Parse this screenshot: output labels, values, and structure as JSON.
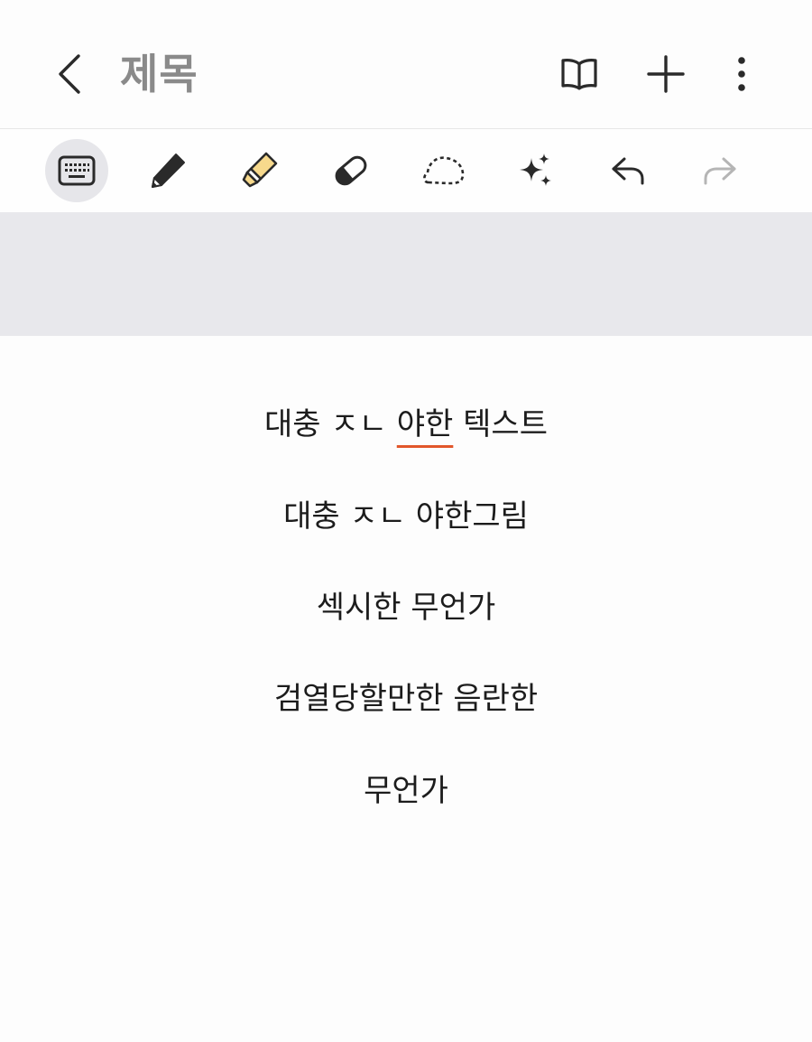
{
  "header": {
    "back_icon": "chevron-left-icon",
    "title": "제목",
    "actions": [
      {
        "icon": "book-open-icon"
      },
      {
        "icon": "plus-icon"
      },
      {
        "icon": "more-vertical-icon"
      }
    ]
  },
  "toolbar": {
    "tools": [
      {
        "icon": "keyboard-icon",
        "active": true
      },
      {
        "icon": "pen-icon",
        "active": false
      },
      {
        "icon": "highlighter-icon",
        "active": false
      },
      {
        "icon": "eraser-icon",
        "active": false
      },
      {
        "icon": "lasso-icon",
        "active": false
      },
      {
        "icon": "sparkle-icon",
        "active": false
      },
      {
        "icon": "undo-icon",
        "active": false
      },
      {
        "icon": "redo-icon",
        "active": false,
        "disabled": true
      }
    ]
  },
  "colors": {
    "title": "#8a8a8a",
    "band": "#e8e8ec",
    "highlighter": "#f7d98c",
    "spellcheck_underline": "#e2572b",
    "active_tool_bg": "#e6e6ea",
    "disabled_icon": "#b5b5b5"
  },
  "note": {
    "lines": [
      {
        "before": "대충 ㅈㄴ ",
        "underlined": "야한",
        "after": " 텍스트"
      },
      {
        "text": "대충 ㅈㄴ 야한그림"
      },
      {
        "text": "섹시한 무언가"
      },
      {
        "text": "검열당할만한 음란한"
      },
      {
        "text": "무언가"
      }
    ]
  }
}
